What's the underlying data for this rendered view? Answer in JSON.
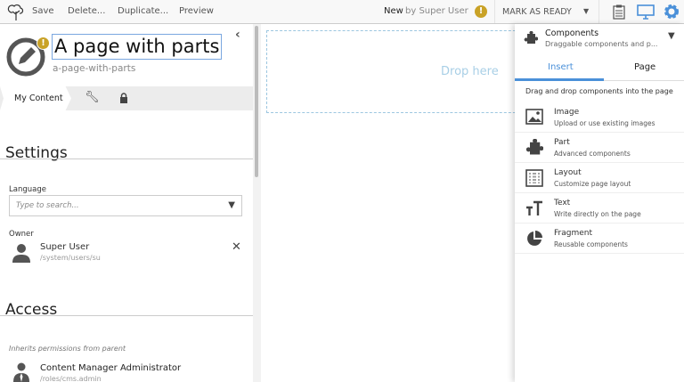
{
  "toolbar": {
    "save": "Save",
    "delete": "Delete...",
    "duplicate": "Duplicate...",
    "preview": "Preview",
    "status": "New",
    "by": "by Super User",
    "mark_ready": "MARK AS READY"
  },
  "content": {
    "title": "A page with parts",
    "path": "a-page-with-parts",
    "tab_my_content": "My Content"
  },
  "settings": {
    "heading": "Settings",
    "language_label": "Language",
    "language_placeholder": "Type to search...",
    "owner_label": "Owner",
    "owner_name": "Super User",
    "owner_path": "/system/users/su"
  },
  "access": {
    "heading": "Access",
    "inherits": "Inherits permissions from parent",
    "principal_name": "Content Manager Administrator",
    "principal_path": "/roles/cms.admin"
  },
  "canvas": {
    "drop_here": "Drop here"
  },
  "panel": {
    "title": "Components",
    "subtitle": "Draggable components and p...",
    "tab_insert": "Insert",
    "tab_page": "Page",
    "hint": "Drag and drop components into the page",
    "items": [
      {
        "title": "Image",
        "desc": "Upload or use existing images"
      },
      {
        "title": "Part",
        "desc": "Advanced components"
      },
      {
        "title": "Layout",
        "desc": "Customize page layout"
      },
      {
        "title": "Text",
        "desc": "Write directly on the page"
      },
      {
        "title": "Fragment",
        "desc": "Reusable components"
      }
    ]
  },
  "colors": {
    "accent": "#4a90d9",
    "warning": "#c9a227"
  }
}
